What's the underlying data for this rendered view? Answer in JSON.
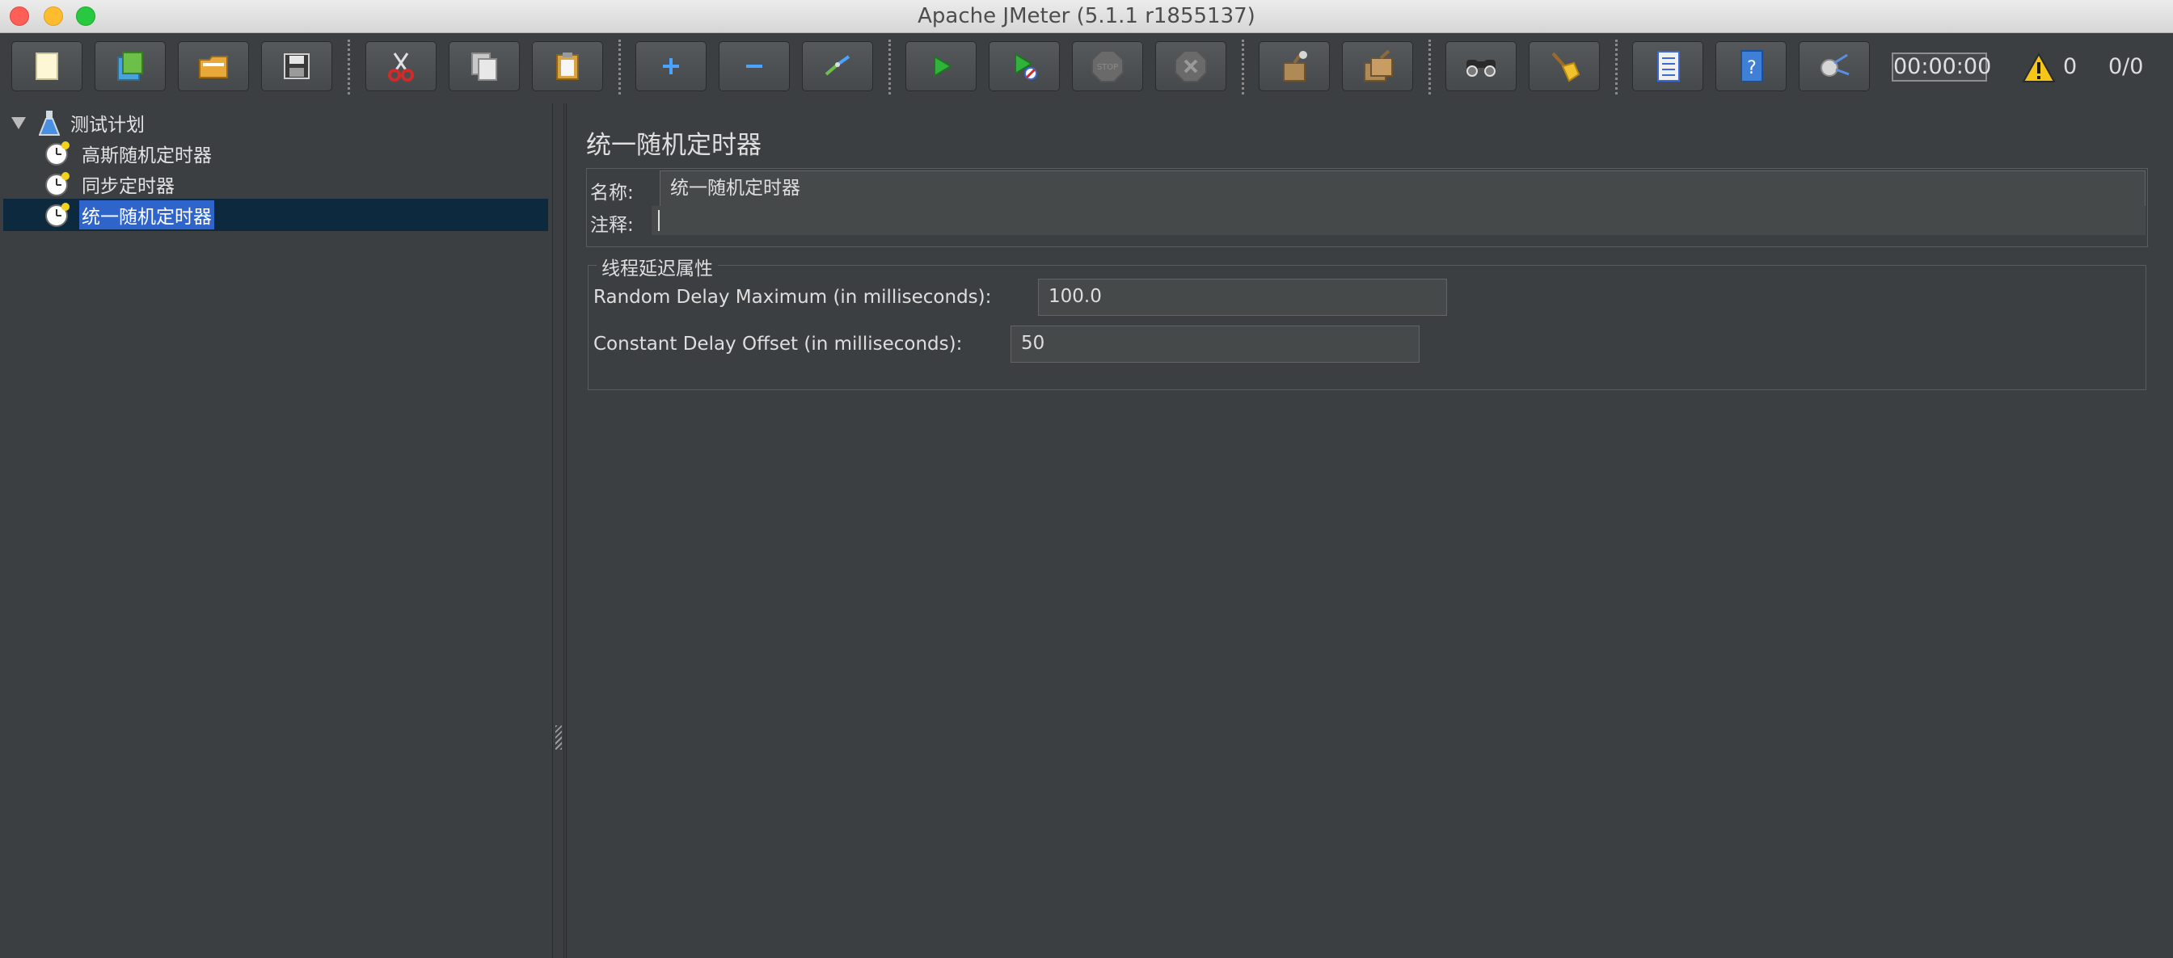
{
  "window": {
    "title": "Apache JMeter (5.1.1 r1855137)"
  },
  "toolbar": {
    "buttons": [
      {
        "name": "new-icon"
      },
      {
        "name": "templates-icon"
      },
      {
        "name": "open-icon"
      },
      {
        "name": "save-icon"
      },
      {
        "name": "cut-icon"
      },
      {
        "name": "copy-icon"
      },
      {
        "name": "paste-icon"
      },
      {
        "name": "expand-icon"
      },
      {
        "name": "collapse-icon"
      },
      {
        "name": "toggle-icon"
      },
      {
        "name": "start-icon"
      },
      {
        "name": "start-no-pause-icon"
      },
      {
        "name": "stop-icon"
      },
      {
        "name": "shutdown-icon"
      },
      {
        "name": "clear-icon"
      },
      {
        "name": "clear-all-icon"
      },
      {
        "name": "search-icon"
      },
      {
        "name": "reset-search-icon"
      },
      {
        "name": "function-helper-icon"
      },
      {
        "name": "help-icon"
      },
      {
        "name": "remote-icon"
      }
    ],
    "stop_label": "STOP",
    "help_label": "?",
    "timer": "00:00:00",
    "warning_count": "0",
    "thread_ratio": "0/0"
  },
  "tree": {
    "root": "测试计划",
    "items": [
      {
        "label": "高斯随机定时器",
        "selected": false
      },
      {
        "label": "同步定时器",
        "selected": false
      },
      {
        "label": "统一随机定时器",
        "selected": true
      }
    ]
  },
  "panel": {
    "title": "统一随机定时器",
    "name_label": "名称:",
    "name_value": "统一随机定时器",
    "comment_label": "注释:",
    "comment_value": "",
    "group_title": "线程延迟属性",
    "random_delay_label": "Random Delay Maximum (in milliseconds):",
    "random_delay_value": "100.0",
    "constant_delay_label": "Constant Delay Offset (in milliseconds):",
    "constant_delay_value": "50"
  }
}
